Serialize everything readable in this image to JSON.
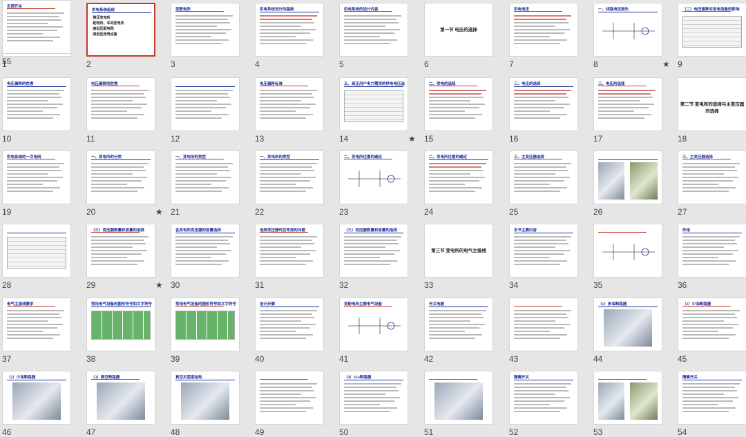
{
  "app": {
    "view": "slide_sorter"
  },
  "selected_slide": 2,
  "slides": [
    {
      "n": "1",
      "title": "供电系统",
      "star": ""
    },
    {
      "n": "2",
      "title": "供电系统组成",
      "items": [
        "·降压变电所",
        "·配电所、车间变电所",
        "·高低压配电网",
        "·高低压用电设备"
      ],
      "star": ""
    },
    {
      "n": "3",
      "title": "变配电所",
      "star": ""
    },
    {
      "n": "4",
      "title": "供电系统设计的基础",
      "star": ""
    },
    {
      "n": "5",
      "title": "供电系统的设计内容",
      "star": ""
    },
    {
      "n": "6",
      "title": "第一节 电压的选择",
      "star": ""
    },
    {
      "n": "7",
      "title": "供电电压",
      "star": ""
    },
    {
      "n": "8",
      "title": "一、线路电压损失",
      "star": "★"
    },
    {
      "n": "9",
      "title": "（二）电压偏移对用电设备的影响",
      "star": ""
    },
    {
      "n": "10",
      "title": "电压偏移的危害",
      "star": ""
    },
    {
      "n": "11",
      "title": "电压偏移的危害",
      "star": ""
    },
    {
      "n": "12",
      "title": "",
      "star": ""
    },
    {
      "n": "13",
      "title": "电压偏移标准",
      "star": ""
    },
    {
      "n": "14",
      "title": "五、高压用户电力需求的供电电压选择",
      "star": "★"
    },
    {
      "n": "15",
      "title": "二、供电的选择",
      "star": ""
    },
    {
      "n": "16",
      "title": "三、电压的选择",
      "star": ""
    },
    {
      "n": "17",
      "title": "三、电压的选择",
      "star": ""
    },
    {
      "n": "18",
      "title": "第二节 变电所的选择与主变压器的选择",
      "star": ""
    },
    {
      "n": "19",
      "title": "供电系统的一次电网",
      "star": ""
    },
    {
      "n": "20",
      "title": "一、变电所的分类",
      "star": "★"
    },
    {
      "n": "21",
      "title": "一、变电所的类型",
      "star": ""
    },
    {
      "n": "22",
      "title": "一、变电所的类型",
      "star": ""
    },
    {
      "n": "23",
      "title": "二、变电所位置的确定",
      "star": ""
    },
    {
      "n": "24",
      "title": "二、变电所位置的确定",
      "star": ""
    },
    {
      "n": "25",
      "title": "三、主变压器选择",
      "star": ""
    },
    {
      "n": "26",
      "title": "",
      "star": ""
    },
    {
      "n": "27",
      "title": "三、主变压器选择",
      "star": ""
    },
    {
      "n": "28",
      "title": "",
      "star": ""
    },
    {
      "n": "29",
      "title": "（三）变压器数量和容量的选择",
      "star": "★"
    },
    {
      "n": "30",
      "title": "各变电所变压器的容量选择",
      "star": ""
    },
    {
      "n": "31",
      "title": "选择变压器时应考虑的问题",
      "star": ""
    },
    {
      "n": "32",
      "title": "（三）变压器数量和容量的选择",
      "star": ""
    },
    {
      "n": "33",
      "title": "第三节 变电所的电气主接线",
      "star": ""
    },
    {
      "n": "34",
      "title": "本节主要内容",
      "star": ""
    },
    {
      "n": "35",
      "title": "",
      "star": ""
    },
    {
      "n": "36",
      "title": "作用",
      "star": ""
    },
    {
      "n": "37",
      "title": "电气主接线要求",
      "star": ""
    },
    {
      "n": "38",
      "title": "常用电气设备的图形符号和文字符号",
      "star": ""
    },
    {
      "n": "39",
      "title": "常用电气设备的图形符号和文字符号",
      "star": ""
    },
    {
      "n": "40",
      "title": "设计步骤",
      "star": ""
    },
    {
      "n": "41",
      "title": "变配电所主要电气设备",
      "star": ""
    },
    {
      "n": "42",
      "title": "开关电器",
      "star": ""
    },
    {
      "n": "43",
      "title": "",
      "star": ""
    },
    {
      "n": "44",
      "title": "（1）多油断路器",
      "star": ""
    },
    {
      "n": "45",
      "title": "（2）少油断路器",
      "star": ""
    },
    {
      "n": "46",
      "title": "（2）少油断路器",
      "star": ""
    },
    {
      "n": "47",
      "title": "（3）真空断路器",
      "star": ""
    },
    {
      "n": "48",
      "title": "真空灭弧室结构",
      "star": ""
    },
    {
      "n": "49",
      "title": "",
      "star": ""
    },
    {
      "n": "50",
      "title": "（4）SF6断路器",
      "star": ""
    },
    {
      "n": "51",
      "title": "",
      "star": ""
    },
    {
      "n": "52",
      "title": "隔离开关",
      "star": ""
    },
    {
      "n": "53",
      "title": "",
      "star": ""
    },
    {
      "n": "54",
      "title": "隔离开关",
      "star": ""
    },
    {
      "n": "55",
      "title": "负荷开关",
      "star": ""
    }
  ]
}
